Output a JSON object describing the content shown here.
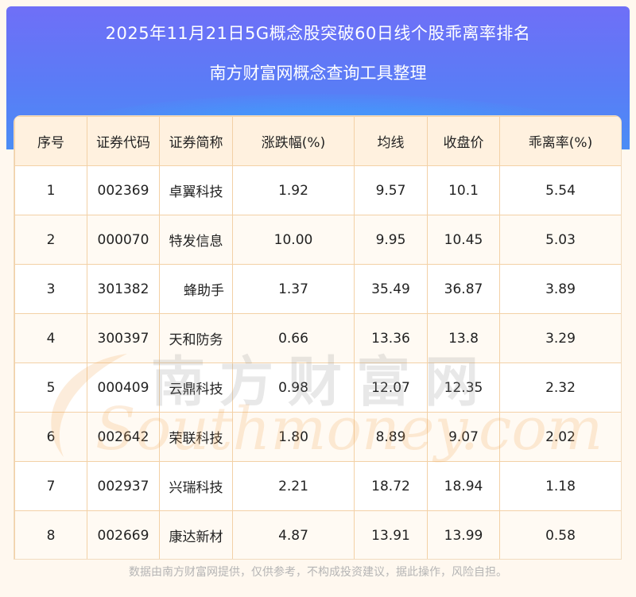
{
  "header": {
    "title": "2025年11月21日5G概念股突破60日线个股乖离率排名",
    "subtitle": "南方财富网概念查询工具整理"
  },
  "table": {
    "columns": [
      "序号",
      "证券代码",
      "证券简称",
      "涨跌幅(%)",
      "均线",
      "收盘价",
      "乖离率(%)"
    ],
    "rows": [
      [
        "1",
        "002369",
        "卓翼科技",
        "1.92",
        "9.57",
        "10.1",
        "5.54"
      ],
      [
        "2",
        "000070",
        "特发信息",
        "10.00",
        "9.95",
        "10.45",
        "5.03"
      ],
      [
        "3",
        "301382",
        "蜂助手",
        "1.37",
        "35.49",
        "36.87",
        "3.89"
      ],
      [
        "4",
        "300397",
        "天和防务",
        "0.66",
        "13.36",
        "13.8",
        "3.29"
      ],
      [
        "5",
        "000409",
        "云鼎科技",
        "0.98",
        "12.07",
        "12.35",
        "2.32"
      ],
      [
        "6",
        "002642",
        "荣联科技",
        "1.80",
        "8.89",
        "9.07",
        "2.02"
      ],
      [
        "7",
        "002937",
        "兴瑞科技",
        "2.21",
        "18.72",
        "18.94",
        "1.18"
      ],
      [
        "8",
        "002669",
        "康达新材",
        "4.87",
        "13.91",
        "13.99",
        "0.58"
      ]
    ]
  },
  "watermark": {
    "cn": "南方财富网",
    "en": "Southmoney.com"
  },
  "footer": {
    "disclaimer": "数据由南方财富网提供，仅供参考，不构成投资建议，据此操作，风险自担。"
  }
}
